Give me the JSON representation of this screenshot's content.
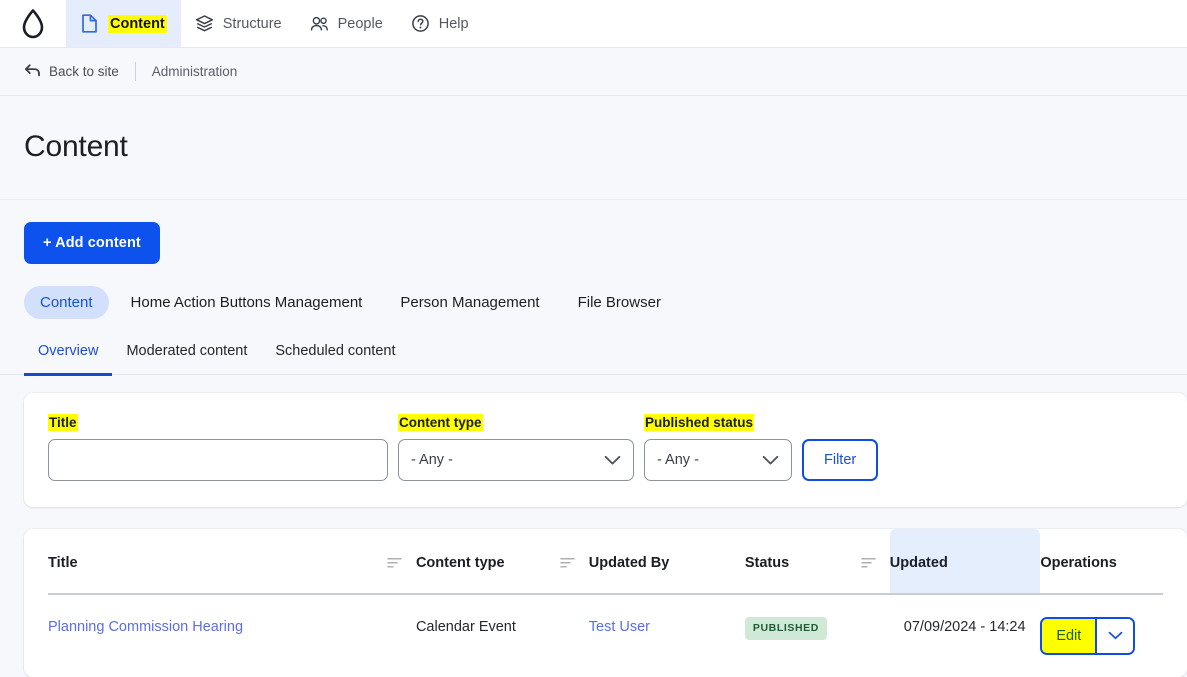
{
  "toolbar": {
    "logo_name": "drupal-droplet-logo",
    "items": [
      {
        "label": "Content",
        "icon": "document-icon",
        "active": true
      },
      {
        "label": "Structure",
        "icon": "layers-icon",
        "active": false
      },
      {
        "label": "People",
        "icon": "people-icon",
        "active": false
      },
      {
        "label": "Help",
        "icon": "question-circle-icon",
        "active": false
      }
    ]
  },
  "breadcrumb": {
    "back_label": "Back to site",
    "back_icon": "back-arrow-icon",
    "current": "Administration"
  },
  "page": {
    "title": "Content"
  },
  "actions": {
    "add_content_label": "+ Add content"
  },
  "primary_tabs": [
    {
      "label": "Content",
      "active": true
    },
    {
      "label": "Home Action Buttons Management",
      "active": false
    },
    {
      "label": "Person Management",
      "active": false
    },
    {
      "label": "File Browser",
      "active": false
    }
  ],
  "secondary_tabs": [
    {
      "label": "Overview",
      "active": true
    },
    {
      "label": "Moderated content",
      "active": false
    },
    {
      "label": "Scheduled content",
      "active": false
    }
  ],
  "filters": {
    "title": {
      "label": "Title",
      "value": "",
      "placeholder": "",
      "highlighted": true
    },
    "content_type": {
      "label": "Content type",
      "value": "- Any -",
      "highlighted": true
    },
    "published_status": {
      "label": "Published status",
      "value": "- Any -",
      "highlighted": true
    },
    "submit_label": "Filter"
  },
  "table": {
    "columns": [
      {
        "label": "Title",
        "sortable": true,
        "sorted": false
      },
      {
        "label": "Content type",
        "sortable": true,
        "sorted": false
      },
      {
        "label": "Updated By",
        "sortable": false,
        "sorted": false
      },
      {
        "label": "Status",
        "sortable": true,
        "sorted": false
      },
      {
        "label": "Updated",
        "sortable": false,
        "sorted": true
      },
      {
        "label": "Operations",
        "sortable": false,
        "sorted": false
      }
    ],
    "rows": [
      {
        "title": "Planning Commission Hearing",
        "content_type": "Calendar Event",
        "updated_by": "Test User",
        "status": "PUBLISHED",
        "updated": "07/09/2024 - 14:24",
        "operations": {
          "edit_label": "Edit",
          "dropdown_icon": "chevron-down-icon"
        }
      }
    ]
  },
  "colors": {
    "brand_blue": "#0d52ec",
    "link_blue": "#5b6ee8",
    "active_tab_blue": "#1a4fd6",
    "highlight_yellow": "#ffff00",
    "published_bg": "#cfe9d6",
    "published_text": "#1f5c35",
    "page_bg": "#f7f8fb"
  }
}
